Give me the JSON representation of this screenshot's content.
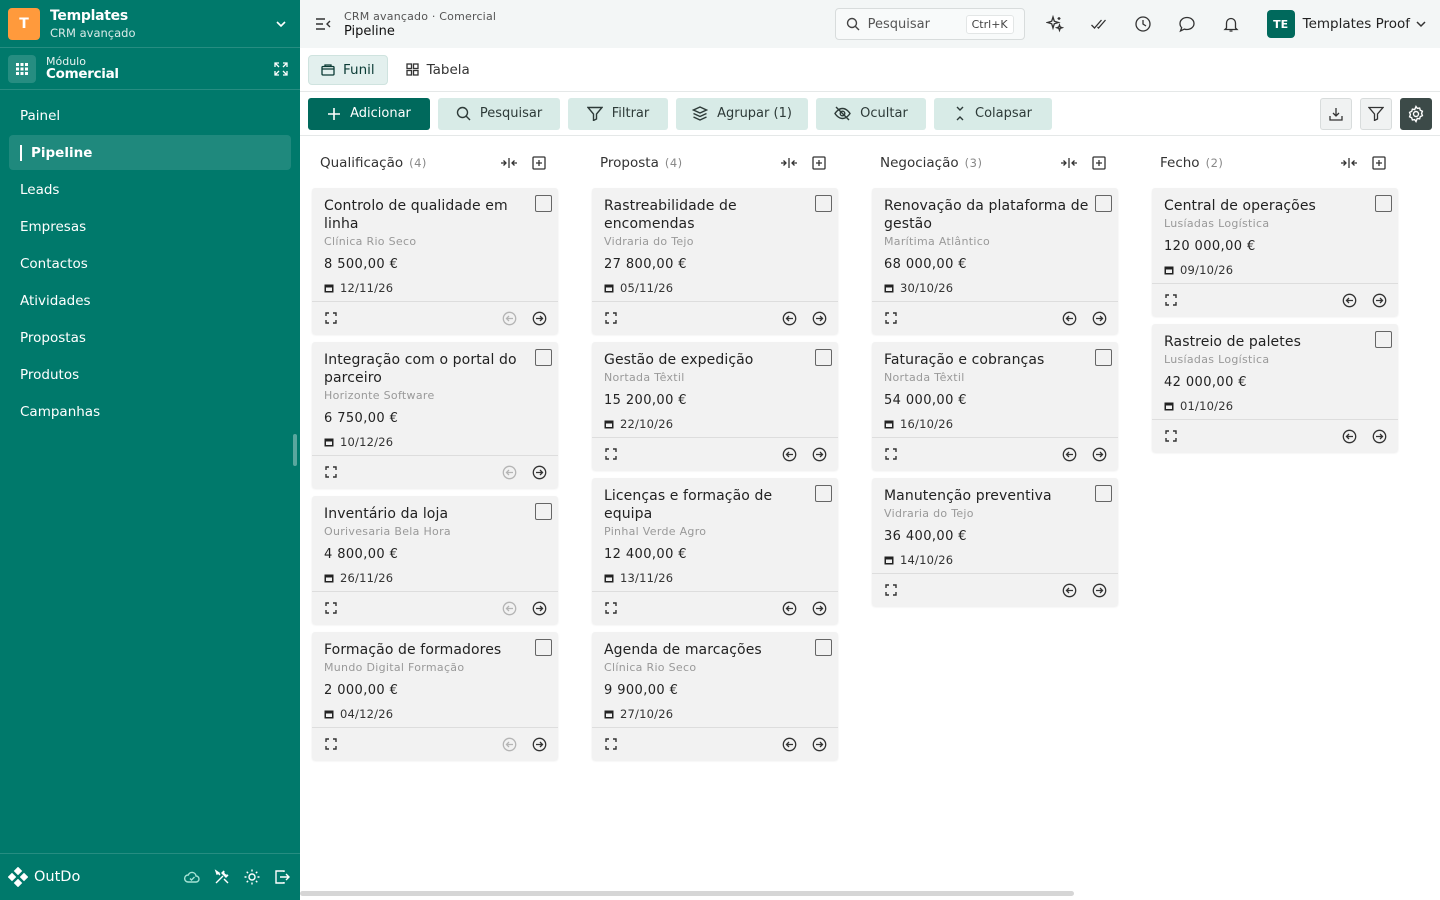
{
  "sidebar": {
    "logo_letter": "T",
    "app_title": "Templates",
    "app_subtitle": "CRM avançado",
    "module_label": "Módulo",
    "module_name": "Comercial",
    "items": [
      {
        "label": "Painel"
      },
      {
        "label": "Pipeline",
        "active": true
      },
      {
        "label": "Leads"
      },
      {
        "label": "Empresas"
      },
      {
        "label": "Contactos"
      },
      {
        "label": "Atividades"
      },
      {
        "label": "Propostas"
      },
      {
        "label": "Produtos"
      },
      {
        "label": "Campanhas"
      }
    ],
    "brand": "OutDo",
    "footer_icons": [
      "cloud-sync-icon",
      "tools-icon",
      "sun-icon",
      "logout-icon"
    ]
  },
  "topbar": {
    "breadcrumb": "CRM avançado · Comercial",
    "page_title": "Pipeline",
    "search_placeholder": "Pesquisar",
    "search_shortcut": "Ctrl+K",
    "icons": [
      "sparkles-icon",
      "check-double-icon",
      "clock-icon",
      "chat-icon",
      "bell-icon"
    ],
    "user_initials": "TE",
    "user_name": "Templates Proof"
  },
  "views": {
    "tabs": [
      {
        "label": "Funil",
        "icon": "funnel-view-icon",
        "active": true
      },
      {
        "label": "Tabela",
        "icon": "grid-icon",
        "active": false
      }
    ]
  },
  "toolbar": {
    "add": "Adicionar",
    "search": "Pesquisar",
    "filter": "Filtrar",
    "group": "Agrupar (1)",
    "hide": "Ocultar",
    "collapse": "Colapsar",
    "right_icons": [
      "download-icon",
      "filter-icon",
      "settings-icon"
    ]
  },
  "colors": {
    "sidebar_bg": "#00796b",
    "primary": "#00695c",
    "toolbar_btn": "#d8ebe7",
    "logo": "#ff9a3c"
  },
  "columns": [
    {
      "name": "Qualificação",
      "count": "(4)",
      "cards": [
        {
          "title": "Controlo de qualidade em linha",
          "company": "Clínica Rio Seco",
          "amount": "8 500,00 €",
          "date": "12/11/26"
        },
        {
          "title": "Integração com o portal do parceiro",
          "company": "Horizonte Software",
          "amount": "6 750,00 €",
          "date": "10/12/26"
        },
        {
          "title": "Inventário da loja",
          "company": "Ourivesaria Bela Hora",
          "amount": "4 800,00 €",
          "date": "26/11/26"
        },
        {
          "title": "Formação de formadores",
          "company": "Mundo Digital Formação",
          "amount": "2 000,00 €",
          "date": "04/12/26"
        }
      ]
    },
    {
      "name": "Proposta",
      "count": "(4)",
      "cards": [
        {
          "title": "Rastreabilidade de encomendas",
          "company": "Vidraria do Tejo",
          "amount": "27 800,00 €",
          "date": "05/11/26"
        },
        {
          "title": "Gestão de expedição",
          "company": "Nortada Têxtil",
          "amount": "15 200,00 €",
          "date": "22/10/26"
        },
        {
          "title": "Licenças e formação de equipa",
          "company": "Pinhal Verde Agro",
          "amount": "12 400,00 €",
          "date": "13/11/26"
        },
        {
          "title": "Agenda de marcações",
          "company": "Clínica Rio Seco",
          "amount": "9 900,00 €",
          "date": "27/10/26"
        }
      ]
    },
    {
      "name": "Negociação",
      "count": "(3)",
      "cards": [
        {
          "title": "Renovação da plataforma de gestão",
          "company": "Marítima Atlântico",
          "amount": "68 000,00 €",
          "date": "30/10/26"
        },
        {
          "title": "Faturação e cobranças",
          "company": "Nortada Têxtil",
          "amount": "54 000,00 €",
          "date": "16/10/26"
        },
        {
          "title": "Manutenção preventiva",
          "company": "Vidraria do Tejo",
          "amount": "36 400,00 €",
          "date": "14/10/26"
        }
      ]
    },
    {
      "name": "Fecho",
      "count": "(2)",
      "cards": [
        {
          "title": "Central de operações",
          "company": "Lusíadas Logística",
          "amount": "120 000,00 €",
          "date": "09/10/26"
        },
        {
          "title": "Rastreio de paletes",
          "company": "Lusíadas Logística",
          "amount": "42 000,00 €",
          "date": "01/10/26"
        }
      ]
    }
  ]
}
